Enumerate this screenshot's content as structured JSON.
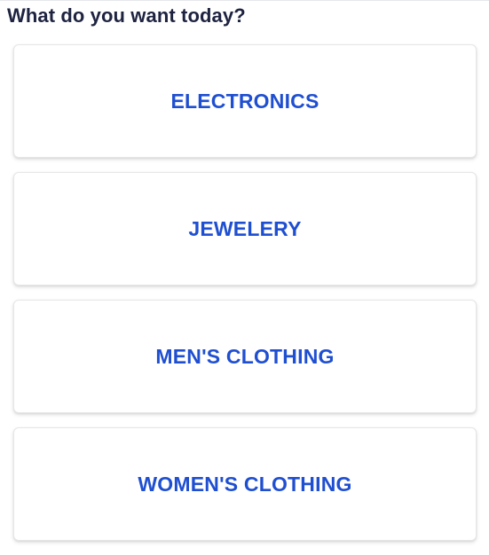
{
  "heading": "What do you want today?",
  "categories": [
    {
      "label": "ELECTRONICS"
    },
    {
      "label": "JEWELERY"
    },
    {
      "label": "MEN'S CLOTHING"
    },
    {
      "label": "WOMEN'S CLOTHING"
    }
  ],
  "colors": {
    "heading": "#1e2340",
    "category_label": "#1f4fd1",
    "card_background": "#ffffff",
    "card_border": "#e6e6e6"
  }
}
